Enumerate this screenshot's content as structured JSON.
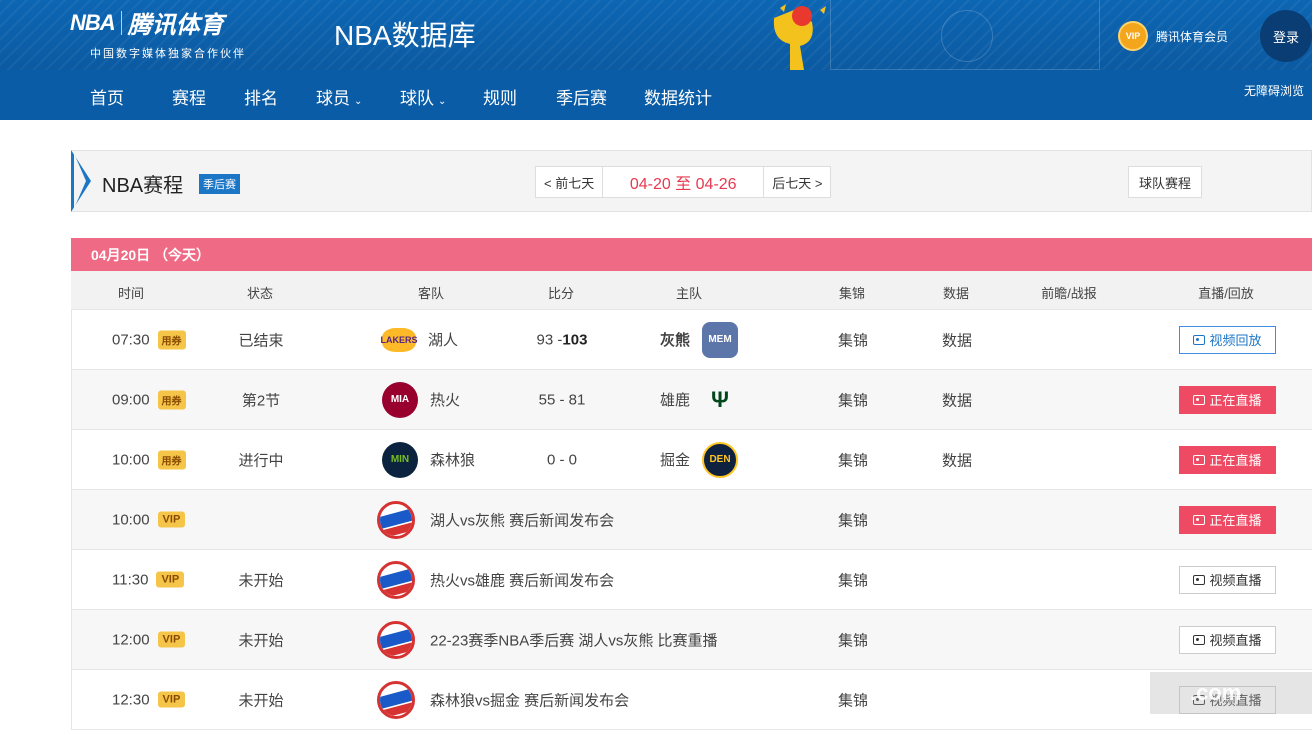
{
  "header": {
    "brand_nba": "NBA",
    "brand_tencent": "腾讯体育",
    "brand_subtitle": "中国数字媒体独家合作伙伴",
    "site_title": "NBA数据库",
    "vip_badge": "VIP",
    "vip_member": "腾讯体育会员",
    "login": "登录",
    "accessible": "无障碍浏览"
  },
  "nav": {
    "items": [
      {
        "label": "首页",
        "dropdown": false
      },
      {
        "label": "赛程",
        "dropdown": false
      },
      {
        "label": "排名",
        "dropdown": false
      },
      {
        "label": "球员",
        "dropdown": true
      },
      {
        "label": "球队",
        "dropdown": true
      },
      {
        "label": "规则",
        "dropdown": false
      },
      {
        "label": "季后赛",
        "dropdown": false
      },
      {
        "label": "数据统计",
        "dropdown": false
      }
    ],
    "caret": "⌄"
  },
  "schedule": {
    "title": "NBA赛程",
    "tag": "季后赛",
    "prev": "< 前七天",
    "range": "04-20 至 04-26",
    "next": "后七天 >",
    "team_schedule": "球队赛程",
    "day_header": "04月20日 （今天）",
    "columns": {
      "time": "时间",
      "status": "状态",
      "away": "客队",
      "score": "比分",
      "home": "主队",
      "highlights": "集锦",
      "stats": "数据",
      "preview": "前瞻/战报",
      "live": "直播/回放"
    },
    "games": [
      {
        "time": "07:30",
        "tag": "用券",
        "status": "已结束",
        "away": "湖人",
        "away_logo": "LAKERS",
        "score_away": "93",
        "score_home": "103",
        "home": "灰熊",
        "home_logo": "MEM",
        "highlights": "集锦",
        "stats": "数据",
        "action": "视频回放",
        "action_type": "replay"
      },
      {
        "time": "09:00",
        "tag": "用券",
        "status": "第2节",
        "away": "热火",
        "away_logo": "MIA",
        "score_away": "55",
        "score_home": "81",
        "home": "雄鹿",
        "home_logo": "Ψ",
        "highlights": "集锦",
        "stats": "数据",
        "action": "正在直播",
        "action_type": "live"
      },
      {
        "time": "10:00",
        "tag": "用券",
        "status": "进行中",
        "away": "森林狼",
        "away_logo": "MIN",
        "score_away": "0",
        "score_home": "0",
        "home": "掘金",
        "home_logo": "DEN",
        "highlights": "集锦",
        "stats": "数据",
        "action": "正在直播",
        "action_type": "live"
      }
    ],
    "events": [
      {
        "time": "10:00",
        "tag": "VIP",
        "status": "",
        "title": "湖人vs灰熊 赛后新闻发布会",
        "highlights": "集锦",
        "action": "正在直播",
        "action_type": "live"
      },
      {
        "time": "11:30",
        "tag": "VIP",
        "status": "未开始",
        "title": "热火vs雄鹿 赛后新闻发布会",
        "highlights": "集锦",
        "action": "视频直播",
        "action_type": "plain"
      },
      {
        "time": "12:00",
        "tag": "VIP",
        "status": "未开始",
        "title": "22-23赛季NBA季后赛 湖人vs灰熊 比赛重播",
        "highlights": "集锦",
        "action": "视频直播",
        "action_type": "plain"
      },
      {
        "time": "12:30",
        "tag": "VIP",
        "status": "未开始",
        "title": "森林狼vs掘金 赛后新闻发布会",
        "highlights": "集锦",
        "action": "视频直播",
        "action_type": "plain"
      }
    ],
    "score_sep": "-"
  },
  "watermark": ".com",
  "colors": {
    "brand_blue": "#0b5fa8",
    "accent_blue": "#1c76c6",
    "day_header_pink": "#ef6a85",
    "live_red": "#ef4a63",
    "range_red": "#e8384f",
    "vip_gold": "#f5c54a"
  }
}
